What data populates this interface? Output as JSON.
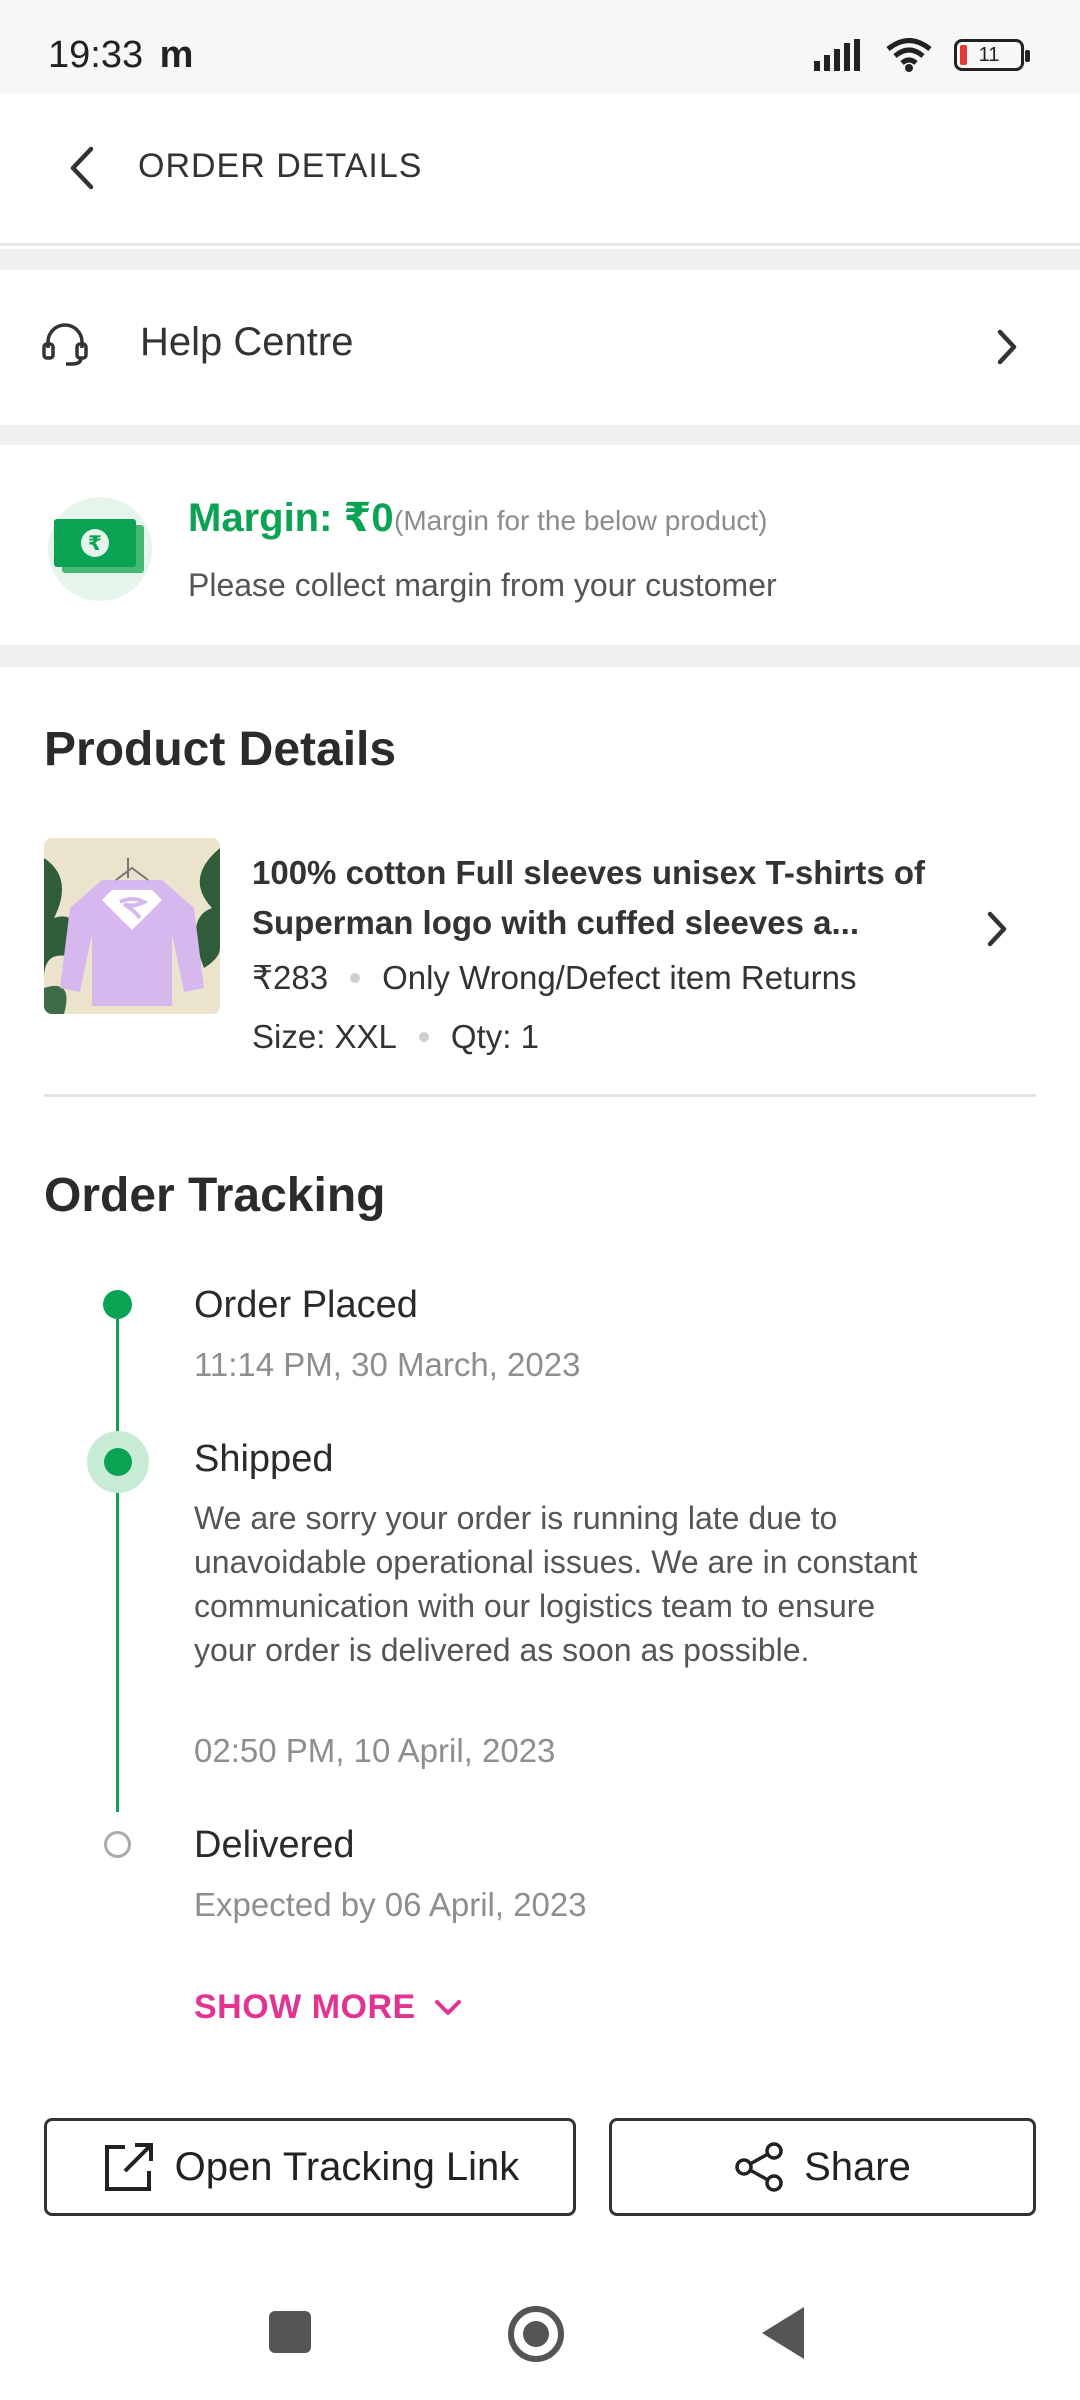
{
  "status_bar": {
    "time": "19:33",
    "carrier_glyph": "m",
    "battery_level": "11"
  },
  "header": {
    "title": "ORDER DETAILS"
  },
  "help_centre": {
    "label": "Help Centre"
  },
  "margin": {
    "title": "Margin: ₹0",
    "note": "(Margin for the below product)",
    "subtitle": "Please collect margin from your customer",
    "accent_color": "#0aa353"
  },
  "product_details": {
    "section_title": "Product Details",
    "name": "100% cotton Full sleeves unisex T-shirts of Superman logo  with cuffed sleeves a...",
    "price": "₹283",
    "return_policy": "Only Wrong/Defect item Returns",
    "size": "Size: XXL",
    "qty": "Qty: 1"
  },
  "order_tracking": {
    "section_title": "Order Tracking",
    "steps": [
      {
        "title": "Order Placed",
        "time": "11:14 PM, 30 March, 2023",
        "status": "done"
      },
      {
        "title": "Shipped",
        "description": "We are sorry your order is running late due to unavoidable operational issues. We are in constant communication with our logistics team to ensure your order is delivered as soon as possible.",
        "time": "02:50 PM, 10 April, 2023",
        "status": "current"
      },
      {
        "title": "Delivered",
        "time": "Expected by 06 April, 2023",
        "status": "pending"
      }
    ],
    "show_more_label": "SHOW MORE",
    "show_more_color": "#e13392"
  },
  "actions": {
    "open_tracking_label": "Open Tracking Link",
    "share_label": "Share"
  }
}
